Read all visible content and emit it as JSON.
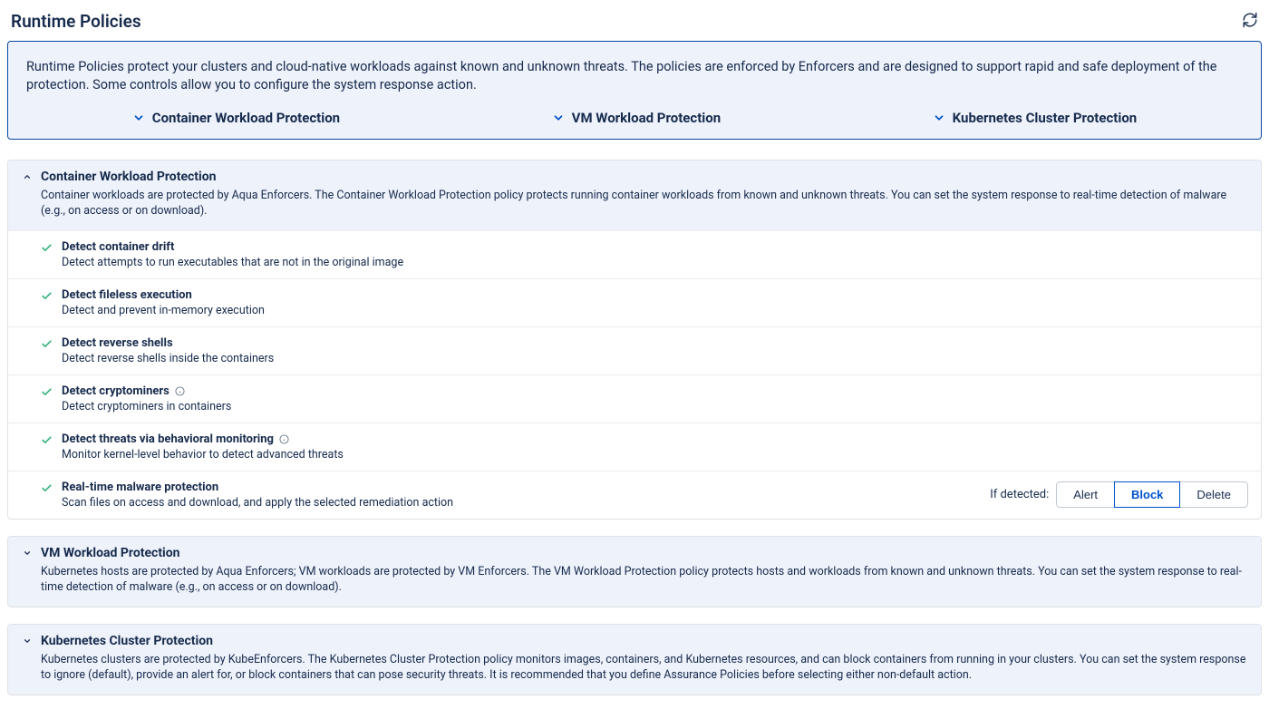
{
  "page_title": "Runtime Policies",
  "intro": "Runtime Policies protect your clusters and cloud-native workloads against known and unknown threats. The policies are enforced by Enforcers and are designed to support rapid and safe deployment of the protection. Some controls allow you to configure the system response action.",
  "tabs": {
    "container": "Container Workload Protection",
    "vm": "VM Workload Protection",
    "k8s": "Kubernetes Cluster Protection"
  },
  "sections": {
    "container": {
      "title": "Container Workload Protection",
      "desc": "Container workloads are protected by Aqua Enforcers. The Container Workload Protection policy protects running container workloads from known and unknown threats. You can set the system response to real-time detection of malware (e.g., on access or on download)."
    },
    "vm": {
      "title": "VM Workload Protection",
      "desc": "Kubernetes hosts are protected by Aqua Enforcers; VM workloads are protected by VM Enforcers. The VM Workload Protection policy protects hosts and workloads from known and unknown threats. You can set the system response to real-time detection of malware (e.g., on access or on download)."
    },
    "k8s": {
      "title": "Kubernetes Cluster Protection",
      "desc": "Kubernetes clusters are protected by KubeEnforcers. The Kubernetes Cluster Protection policy monitors images, containers, and Kubernetes resources, and can block containers from running in your clusters. You can set the system response to ignore (default), provide an alert for, or block containers that can pose security threats. It is recommended that you define Assurance Policies before selecting either non-default action."
    }
  },
  "controls": {
    "drift": {
      "title": "Detect container drift",
      "desc": "Detect attempts to run executables that are not in the original image"
    },
    "fileless": {
      "title": "Detect fileless execution",
      "desc": "Detect and prevent in-memory execution"
    },
    "reverse": {
      "title": "Detect reverse shells",
      "desc": "Detect reverse shells inside the containers"
    },
    "crypto": {
      "title": "Detect cryptominers",
      "desc": "Detect cryptominers in containers"
    },
    "behavioral": {
      "title": "Detect threats via behavioral monitoring",
      "desc": "Monitor kernel-level behavior to detect advanced threats"
    },
    "malware": {
      "title": "Real-time malware protection",
      "desc": "Scan files on access and download, and apply the selected remediation action"
    }
  },
  "actions": {
    "label": "If detected:",
    "alert": "Alert",
    "block": "Block",
    "delete": "Delete"
  }
}
